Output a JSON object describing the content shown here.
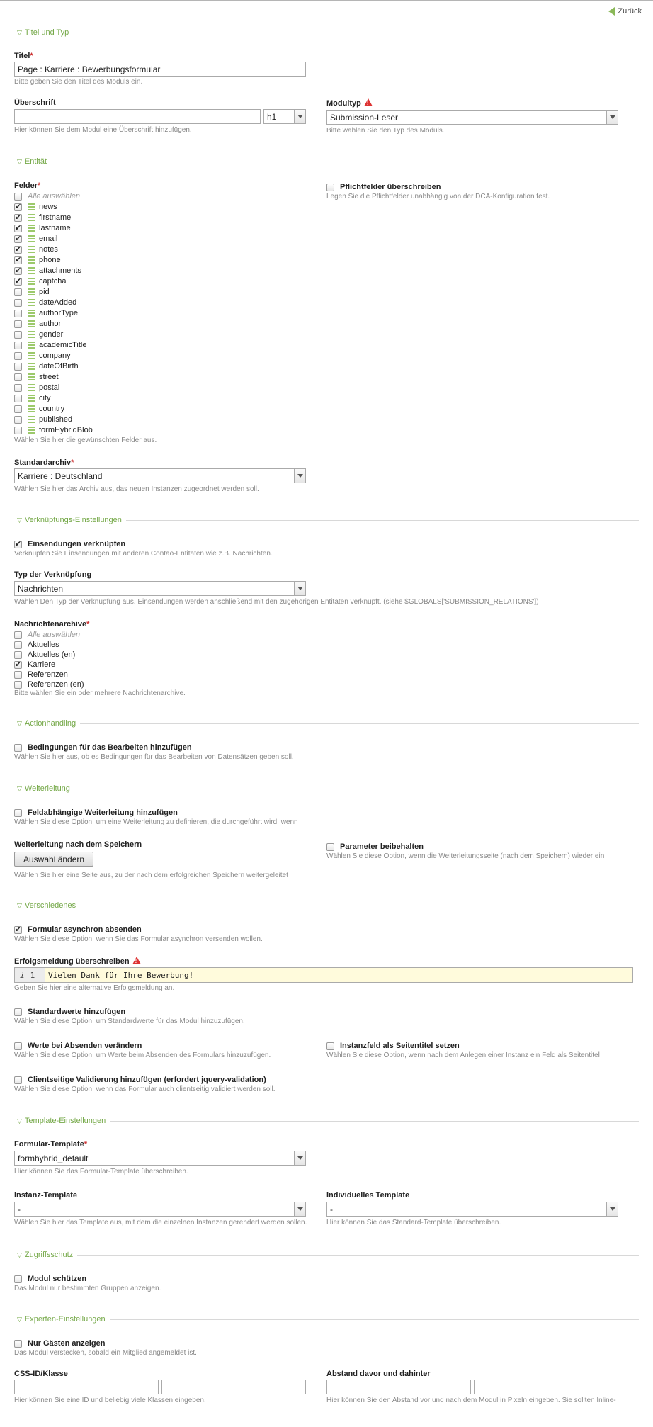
{
  "back_label": "Zurück",
  "sections": {
    "titel": "Titel und Typ",
    "entitaet": "Entität",
    "verknuepfung": "Verknüpfungs-Einstellungen",
    "action": "Actionhandling",
    "weiterleitung": "Weiterleitung",
    "verschiedenes": "Verschiedenes",
    "template": "Template-Einstellungen",
    "zugriff": "Zugriffsschutz",
    "experten": "Experten-Einstellungen"
  },
  "titel": {
    "label": "Titel",
    "value": "Page : Karriere : Bewerbungsformular",
    "help": "Bitte geben Sie den Titel des Moduls ein."
  },
  "ueberschrift": {
    "label": "Überschrift",
    "value": "",
    "hlevel": "h1",
    "help": "Hier können Sie dem Modul eine Überschrift hinzufügen."
  },
  "modultyp": {
    "label": "Modultyp",
    "value": "Submission-Leser",
    "help": "Bitte wählen Sie den Typ des Moduls."
  },
  "felder": {
    "label": "Felder",
    "select_all": "Alle auswählen",
    "items": [
      {
        "name": "news",
        "checked": true
      },
      {
        "name": "firstname",
        "checked": true
      },
      {
        "name": "lastname",
        "checked": true
      },
      {
        "name": "email",
        "checked": true
      },
      {
        "name": "notes",
        "checked": true
      },
      {
        "name": "phone",
        "checked": true
      },
      {
        "name": "attachments",
        "checked": true
      },
      {
        "name": "captcha",
        "checked": true
      },
      {
        "name": "pid",
        "checked": false
      },
      {
        "name": "dateAdded",
        "checked": false
      },
      {
        "name": "authorType",
        "checked": false
      },
      {
        "name": "author",
        "checked": false
      },
      {
        "name": "gender",
        "checked": false
      },
      {
        "name": "academicTitle",
        "checked": false
      },
      {
        "name": "company",
        "checked": false
      },
      {
        "name": "dateOfBirth",
        "checked": false
      },
      {
        "name": "street",
        "checked": false
      },
      {
        "name": "postal",
        "checked": false
      },
      {
        "name": "city",
        "checked": false
      },
      {
        "name": "country",
        "checked": false
      },
      {
        "name": "published",
        "checked": false
      },
      {
        "name": "formHybridBlob",
        "checked": false
      }
    ],
    "help": "Wählen Sie hier die gewünschten Felder aus."
  },
  "pflicht": {
    "label": "Pflichtfelder überschreiben",
    "help": "Legen Sie die Pflichtfelder unabhängig von der DCA-Konfiguration fest."
  },
  "standardarchiv": {
    "label": "Standardarchiv",
    "value": "Karriere : Deutschland",
    "help": "Wählen Sie hier das Archiv aus, das neuen Instanzen zugeordnet werden soll."
  },
  "einsendungen": {
    "label": "Einsendungen verknüpfen",
    "help": "Verknüpfen Sie Einsendungen mit anderen Contao-Entitäten wie z.B. Nachrichten."
  },
  "typ_verknuepfung": {
    "label": "Typ der Verknüpfung",
    "value": "Nachrichten",
    "help": "Wählen Den Typ der Verknüpfung aus. Einsendungen werden anschließend mit den zugehörigen Entitäten verknüpft. (siehe $GLOBALS['SUBMISSION_RELATIONS'])"
  },
  "nachrichtenarchive": {
    "label": "Nachrichtenarchive",
    "select_all": "Alle auswählen",
    "items": [
      {
        "name": "Aktuelles",
        "checked": false
      },
      {
        "name": "Aktuelles (en)",
        "checked": false
      },
      {
        "name": "Karriere",
        "checked": true
      },
      {
        "name": "Referenzen",
        "checked": false
      },
      {
        "name": "Referenzen (en)",
        "checked": false
      }
    ],
    "help": "Bitte wählen Sie ein oder mehrere Nachrichtenarchive."
  },
  "bedingungen": {
    "label": "Bedingungen für das Bearbeiten hinzufügen",
    "help": "Wählen Sie hier aus, ob es Bedingungen für das Bearbeiten von Datensätzen geben soll."
  },
  "feldabh": {
    "label": "Feldabhängige Weiterleitung hinzufügen",
    "help": "Wählen Sie diese Option, um eine Weiterleitung zu definieren, die durchgeführt wird, wenn"
  },
  "wl_speichern": {
    "label": "Weiterleitung nach dem Speichern",
    "button": "Auswahl ändern",
    "help": "Wählen Sie hier eine Seite aus, zu der nach dem erfolgreichen Speichern weitergeleitet"
  },
  "parameter": {
    "label": "Parameter beibehalten",
    "help": "Wählen Sie diese Option, wenn die Weiterleitungsseite (nach dem Speichern) wieder ein"
  },
  "asynchron": {
    "label": "Formular asynchron absenden",
    "help": "Wählen Sie diese Option, wenn Sie das Formular asynchron versenden wollen."
  },
  "erfolg": {
    "label": "Erfolgsmeldung überschreiben",
    "line_no": "1",
    "info": "i",
    "code": "Vielen Dank für Ihre Bewerbung!",
    "help": "Geben Sie hier eine alternative Erfolgsmeldung an."
  },
  "standardwerte": {
    "label": "Standardwerte hinzufügen",
    "help": "Wählen Sie diese Option, um Standardwerte für das Modul hinzuzufügen."
  },
  "werte_absenden": {
    "label": "Werte bei Absenden verändern",
    "help": "Wählen Sie diese Option, um Werte beim Absenden des Formulars hinzuzufügen."
  },
  "instanzfeld": {
    "label": "Instanzfeld als Seitentitel setzen",
    "help": "Wählen Sie diese Option, wenn nach dem Anlegen einer Instanz ein Feld als Seitentitel"
  },
  "clientseitig": {
    "label": "Clientseitige Validierung hinzufügen (erfordert jquery-validation)",
    "help": "Wählen Sie diese Option, wenn das Formular auch clientseitig validiert werden soll."
  },
  "formular_template": {
    "label": "Formular-Template",
    "value": "formhybrid_default",
    "help": "Hier können Sie das Formular-Template überschreiben."
  },
  "instanz_template": {
    "label": "Instanz-Template",
    "value": "-",
    "help": "Wählen Sie hier das Template aus, mit dem die einzelnen Instanzen gerendert werden sollen."
  },
  "indiv_template": {
    "label": "Individuelles Template",
    "value": "-",
    "help": "Hier können Sie das Standard-Template überschreiben."
  },
  "modul_schuetzen": {
    "label": "Modul schützen",
    "help": "Das Modul nur bestimmten Gruppen anzeigen."
  },
  "nur_gaeste": {
    "label": "Nur Gästen anzeigen",
    "help": "Das Modul verstecken, sobald ein Mitglied angemeldet ist."
  },
  "css_id": {
    "label": "CSS-ID/Klasse",
    "value1": "",
    "value2": "",
    "help": "Hier können Sie eine ID und beliebig viele Klassen eingeben."
  },
  "abstand": {
    "label": "Abstand davor und dahinter",
    "value1": "",
    "value2": "",
    "help": "Hier können Sie den Abstand vor und nach dem Modul in Pixeln eingeben. Sie sollten Inline-"
  }
}
